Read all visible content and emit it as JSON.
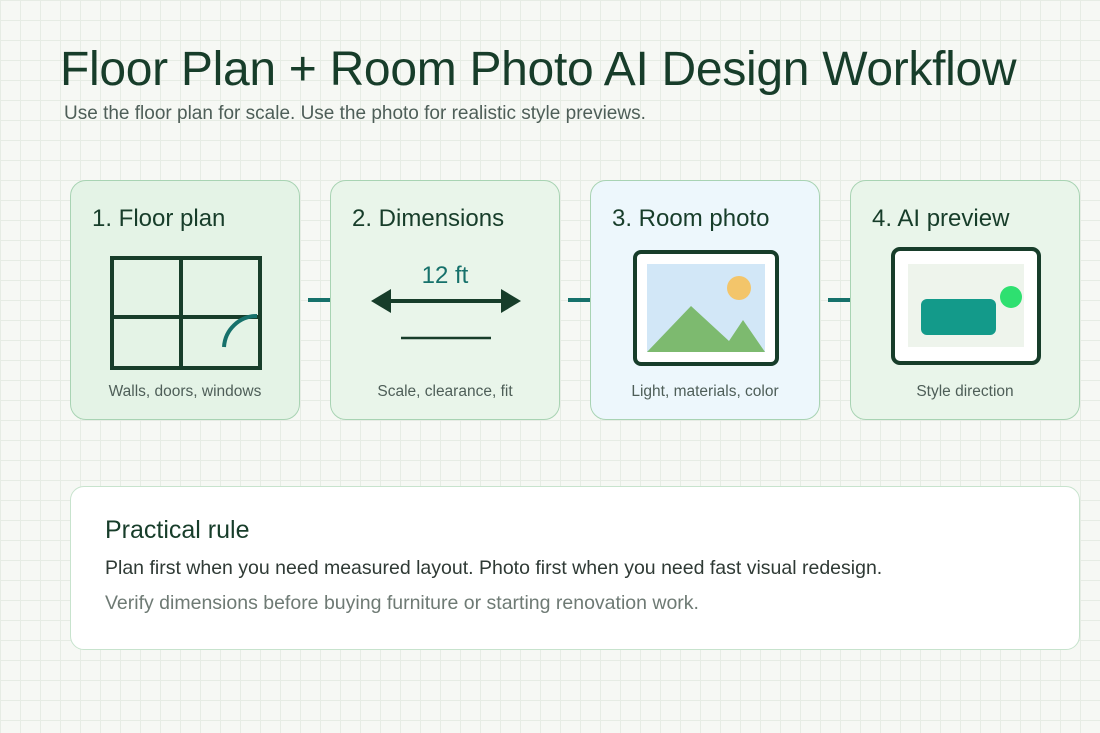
{
  "header": {
    "title": "Floor Plan + Room Photo AI Design Workflow",
    "subtitle": "Use the floor plan for scale. Use the photo for realistic style previews."
  },
  "steps": [
    {
      "title": "1. Floor plan",
      "caption": "Walls, doors, windows",
      "icon": "floor-plan-icon"
    },
    {
      "title": "2. Dimensions",
      "caption": "Scale, clearance, fit",
      "icon": "dimension-arrow-icon",
      "measure_label": "12 ft"
    },
    {
      "title": "3. Room photo",
      "caption": "Light, materials, color",
      "icon": "landscape-photo-icon"
    },
    {
      "title": "4. AI preview",
      "caption": "Style direction",
      "icon": "ai-preview-icon"
    }
  ],
  "rule": {
    "title": "Practical rule",
    "line1": "Plan first when you need measured layout. Photo first when you need fast visual redesign.",
    "line2": "Verify dimensions before buying furniture or starting renovation work."
  },
  "colors": {
    "dark_green": "#173d2a",
    "teal_arrow": "#16716b",
    "card_border": "#a8d3b3",
    "card_green": "#e4f3e6",
    "card_blue": "#edf7fc",
    "mountain": "#7dba6f",
    "sky": "#d2e7f7",
    "sun": "#f3c56a",
    "sofa": "#139a8a",
    "accent_dot": "#2ee070"
  }
}
